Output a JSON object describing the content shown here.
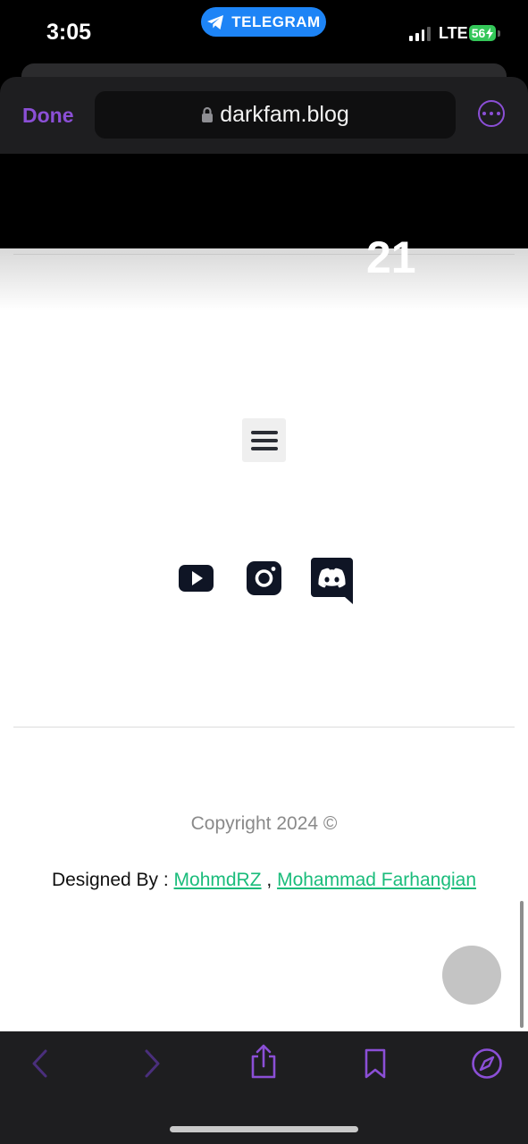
{
  "status_bar": {
    "time": "3:05",
    "pill_label": "TELEGRAM",
    "network": "LTE",
    "battery": "56"
  },
  "browser": {
    "done_label": "Done",
    "url": "darkfam.blog"
  },
  "page": {
    "partial_number": "21",
    "copyright": "Copyright 2024 ©",
    "designed_prefix": "Designed By : ",
    "designer_1": "MohmdRZ",
    "separator": " , ",
    "designer_2": "Mohammad Farhangian"
  },
  "social_icons": [
    "youtube-icon",
    "instagram-icon",
    "discord-icon"
  ],
  "bottom_toolbar_icons": [
    "back-icon",
    "forward-icon",
    "share-icon",
    "bookmarks-icon",
    "compass-icon"
  ],
  "colors": {
    "accent": "#8b4fd6",
    "link": "#1abc7b",
    "telegram": "#1d84f6",
    "battery": "#34c759"
  }
}
